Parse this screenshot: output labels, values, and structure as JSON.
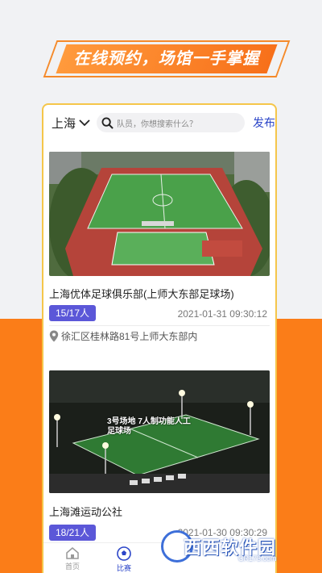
{
  "banner": {
    "slogan": "在线预约，场馆一手掌握"
  },
  "topbar": {
    "city": "上海",
    "search_placeholder": "队员，你想搜索什么？",
    "publish_label": "发布"
  },
  "cards": [
    {
      "title": "上海优体足球俱乐部(上师大东部足球场)",
      "players": "15/17人",
      "time": "2021-01-31 09:30:12",
      "address": "徐汇区桂林路81号上师大东部内",
      "image_caption": ""
    },
    {
      "title": "上海滩运动公社",
      "players": "18/21人",
      "time": "2021-01-30 09:30:29",
      "image_caption": "3号场地 7人制功能人工足球场"
    }
  ],
  "tabs": [
    {
      "label": "首页",
      "icon": "home-icon"
    },
    {
      "label": "比赛",
      "icon": "soccer-ball-icon"
    }
  ],
  "watermark": {
    "text": "西西软件园",
    "sub": "CR173.com"
  },
  "colors": {
    "accent_orange": "#fb7d18",
    "brand_blue": "#2b45c8",
    "badge_purple": "#5b57d8",
    "frame_yellow": "#f5c64a"
  }
}
